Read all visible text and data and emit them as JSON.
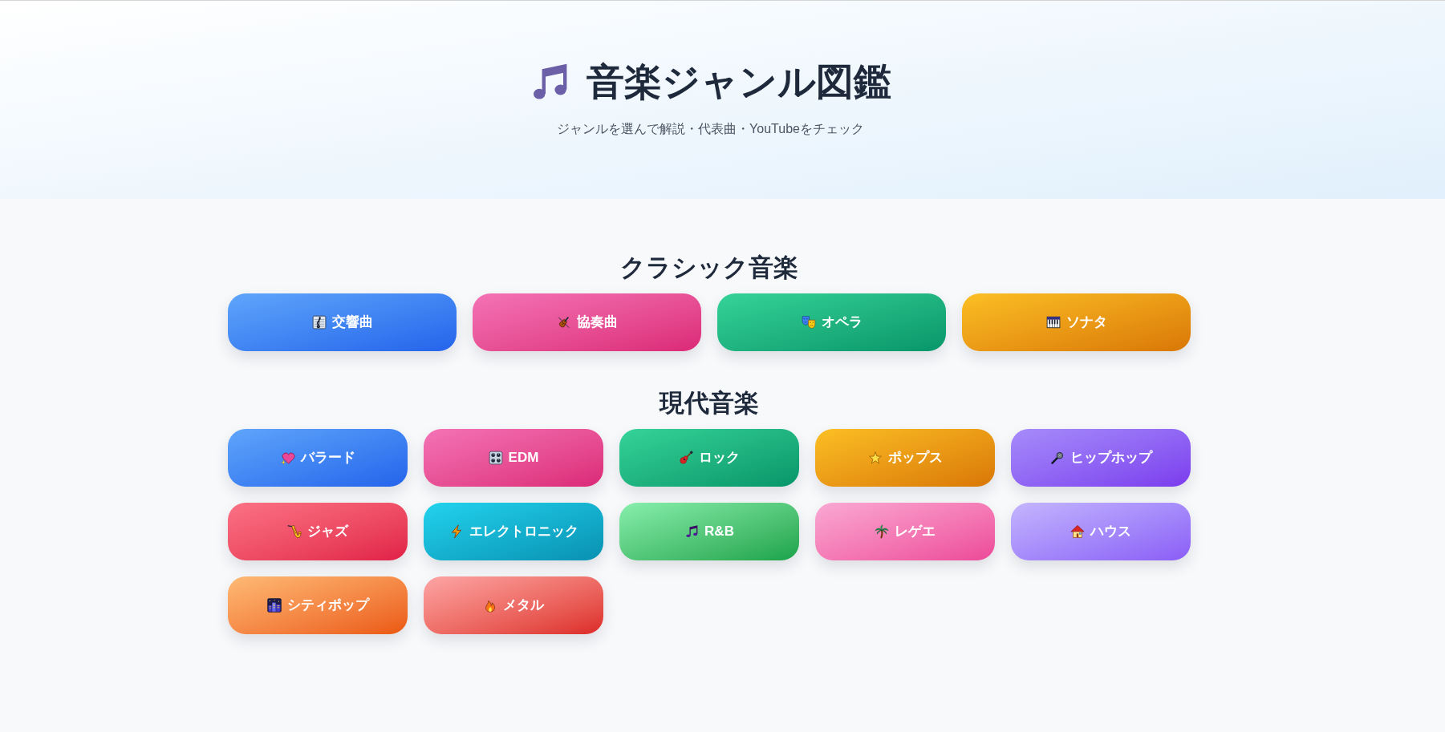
{
  "header": {
    "title": "音楽ジャンル図鑑",
    "subtitle": "ジャンルを選んで解説・代表曲・YouTubeをチェック"
  },
  "sections": [
    {
      "title": "クラシック音楽",
      "genres": [
        {
          "label": "交響曲"
        },
        {
          "label": "協奏曲"
        },
        {
          "label": "オペラ"
        },
        {
          "label": "ソナタ"
        }
      ]
    },
    {
      "title": "現代音楽",
      "genres": [
        {
          "label": "バラード"
        },
        {
          "label": "EDM"
        },
        {
          "label": "ロック"
        },
        {
          "label": "ポップス"
        },
        {
          "label": "ヒップホップ"
        },
        {
          "label": "ジャズ"
        },
        {
          "label": "エレクトロニック"
        },
        {
          "label": "R&B"
        },
        {
          "label": "レゲエ"
        },
        {
          "label": "ハウス"
        },
        {
          "label": "シティポップ"
        },
        {
          "label": "メタル"
        }
      ]
    }
  ]
}
